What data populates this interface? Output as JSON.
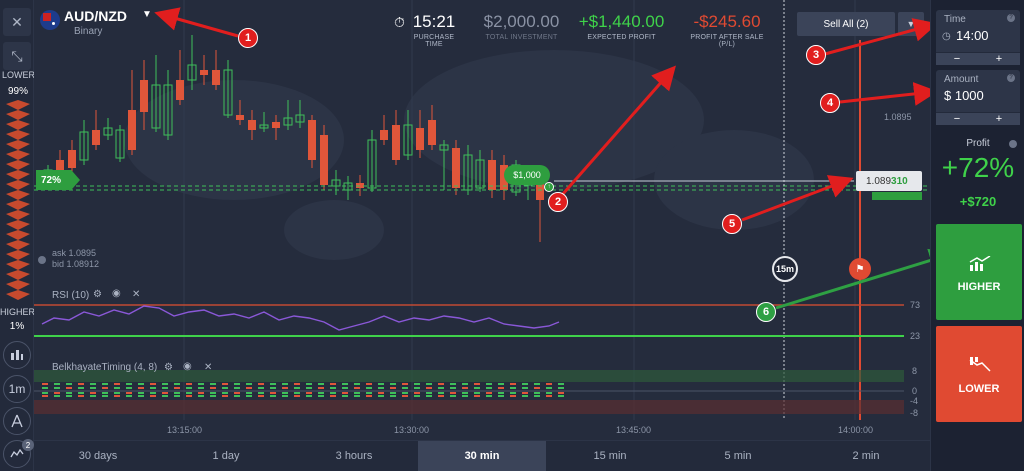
{
  "asset": {
    "name": "AUD/NZD",
    "type": "Binary",
    "dropdown_icon": "caret-down-icon"
  },
  "stats": {
    "purchase_time": {
      "value": "15:21",
      "label": "PURCHASE TIME"
    },
    "total_investment": {
      "value": "$2,000.00",
      "label": "TOTAL INVESTMENT"
    },
    "expected_profit": {
      "value": "+$1,440.00",
      "label": "EXPECTED PROFIT"
    },
    "profit_after_sale": {
      "value": "-$245.60",
      "label": "PROFIT AFTER SALE",
      "sub": "(P/L)"
    }
  },
  "sell_all": {
    "label": "Sell All (2)"
  },
  "left": {
    "lower_label": "LOWER",
    "lower_pct": "99%",
    "higher_label": "HIGHER",
    "higher_pct": "1%",
    "timeframe": "1m",
    "notif_count": "2",
    "indicator_pct": "72%"
  },
  "chart": {
    "ask": "ask 1.0895",
    "bid": "bid 1.08912",
    "price_1": "1.0895",
    "current_price_prefix": "1.089",
    "current_price_suffix": "310",
    "position_label": "$1,000",
    "timer_label": "15m",
    "rsi_label": "RSI (10)",
    "rsi_high": "73",
    "rsi_low": "23",
    "belk_label": "BelkhayateTiming (4, 8)",
    "belk_8": "8",
    "belk_0": "0",
    "belk_m4": "-4",
    "belk_m8": "-8",
    "time_labels": [
      "13:15:00",
      "13:30:00",
      "13:45:00",
      "14:00:00"
    ]
  },
  "right": {
    "time_label": "Time",
    "time_value": "14:00",
    "amount_label": "Amount",
    "amount_value": "$ 1000",
    "minus": "−",
    "plus": "+",
    "profit_label": "Profit",
    "profit_pct": "+72%",
    "profit_amount": "+$720",
    "higher_btn": "HIGHER",
    "lower_btn": "LOWER"
  },
  "timeframes": [
    "30 days",
    "1 day",
    "3 hours",
    "30 min",
    "15 min",
    "5 min",
    "2 min"
  ],
  "active_timeframe": "30 min",
  "annotations": [
    "1",
    "2",
    "3",
    "4",
    "5",
    "6"
  ],
  "colors": {
    "up": "#3fbf5a",
    "down": "#e0563a",
    "accent": "#2ea043",
    "danger": "#e04a32"
  }
}
